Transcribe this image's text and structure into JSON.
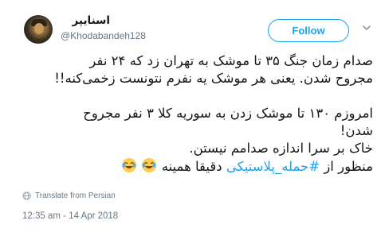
{
  "tweet": {
    "display_name": "اسنایپر",
    "handle": "@Khodabandeh128",
    "follow_label": "Follow",
    "lines": [
      "صدام زمان جنگ ۳۵ تا موشک به تهران زد که ۲۴ نفر",
      "مجروح شدن. یعنی هر موشک یه نفرم نتونست زخمی‌کنه!!",
      "امروزم ۱۳۰ تا موشک زدن به سوریه کلا ۳ نفر مجروح",
      "شدن!",
      "خاک بر سرا اندازه صدامم نیستن.",
      "منظور از",
      "#حمله_پلاستیکی",
      "دقیقا همینه"
    ],
    "emojis": [
      "joy-emoji",
      "joy-emoji"
    ],
    "translate_label": "Translate from Persian",
    "timestamp": "12:35 am - 14 Apr 2018"
  },
  "colors": {
    "accent": "#1da1f2",
    "text": "#14171a",
    "muted": "#657786"
  }
}
